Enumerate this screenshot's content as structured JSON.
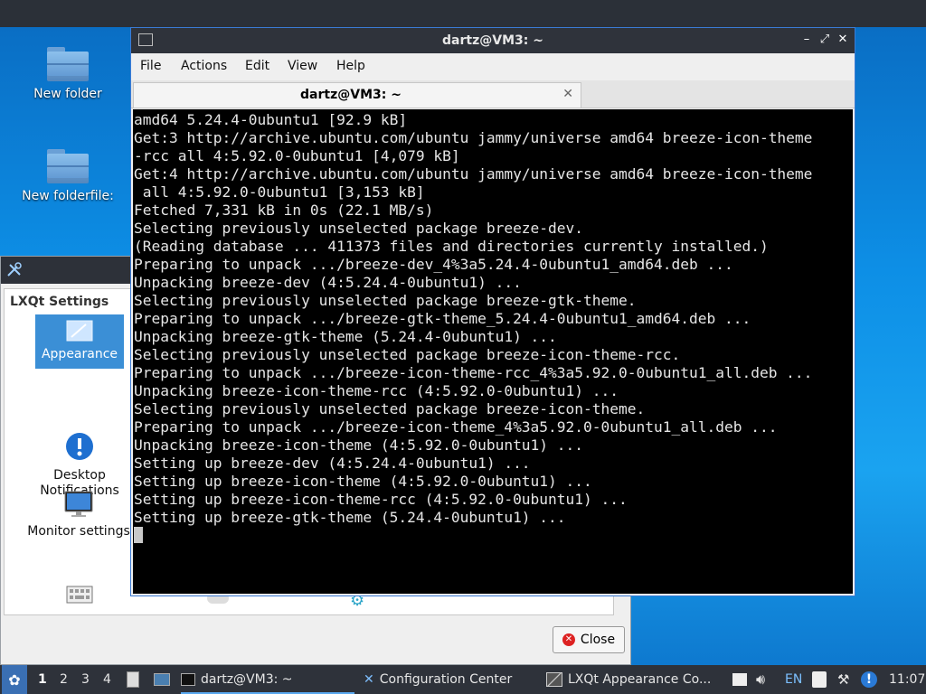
{
  "desktop": {
    "icons": [
      {
        "label": "New folder"
      },
      {
        "label": "New folderfile:"
      }
    ]
  },
  "config_center": {
    "group_label": "LXQt Settings",
    "items": [
      {
        "label": "Appearance"
      },
      {
        "label": "Desktop\nNotifications"
      },
      {
        "label": "Monitor settings"
      }
    ],
    "close_label": "Close"
  },
  "terminal": {
    "title": "dartz@VM3: ~",
    "menu": [
      "File",
      "Actions",
      "Edit",
      "View",
      "Help"
    ],
    "tab_label": "dartz@VM3: ~",
    "output": "amd64 5.24.4-0ubuntu1 [92.9 kB]\nGet:3 http://archive.ubuntu.com/ubuntu jammy/universe amd64 breeze-icon-theme\n-rcc all 4:5.92.0-0ubuntu1 [4,079 kB]\nGet:4 http://archive.ubuntu.com/ubuntu jammy/universe amd64 breeze-icon-theme\n all 4:5.92.0-0ubuntu1 [3,153 kB]\nFetched 7,331 kB in 0s (22.1 MB/s)\nSelecting previously unselected package breeze-dev.\n(Reading database ... 411373 files and directories currently installed.)\nPreparing to unpack .../breeze-dev_4%3a5.24.4-0ubuntu1_amd64.deb ...\nUnpacking breeze-dev (4:5.24.4-0ubuntu1) ...\nSelecting previously unselected package breeze-gtk-theme.\nPreparing to unpack .../breeze-gtk-theme_5.24.4-0ubuntu1_amd64.deb ...\nUnpacking breeze-gtk-theme (5.24.4-0ubuntu1) ...\nSelecting previously unselected package breeze-icon-theme-rcc.\nPreparing to unpack .../breeze-icon-theme-rcc_4%3a5.92.0-0ubuntu1_all.deb ...\nUnpacking breeze-icon-theme-rcc (4:5.92.0-0ubuntu1) ...\nSelecting previously unselected package breeze-icon-theme.\nPreparing to unpack .../breeze-icon-theme_4%3a5.92.0-0ubuntu1_all.deb ...\nUnpacking breeze-icon-theme (4:5.92.0-0ubuntu1) ...\nSetting up breeze-dev (4:5.24.4-0ubuntu1) ...\nSetting up breeze-icon-theme (4:5.92.0-0ubuntu1) ...\nSetting up breeze-icon-theme-rcc (4:5.92.0-0ubuntu1) ...\nSetting up breeze-gtk-theme (5.24.4-0ubuntu1) ...\n"
  },
  "taskbar": {
    "desktops": [
      "1",
      "2",
      "3",
      "4"
    ],
    "tasks": [
      {
        "label": "dartz@VM3: ~"
      },
      {
        "label": "Configuration Center"
      },
      {
        "label": "LXQt Appearance Co..."
      }
    ],
    "keyboard_layout": "EN",
    "clock": "11:07"
  },
  "colors": {
    "accent": "#3b8fd6",
    "terminal_bg": "#000000",
    "taskbar_bg": "#2e323a"
  }
}
